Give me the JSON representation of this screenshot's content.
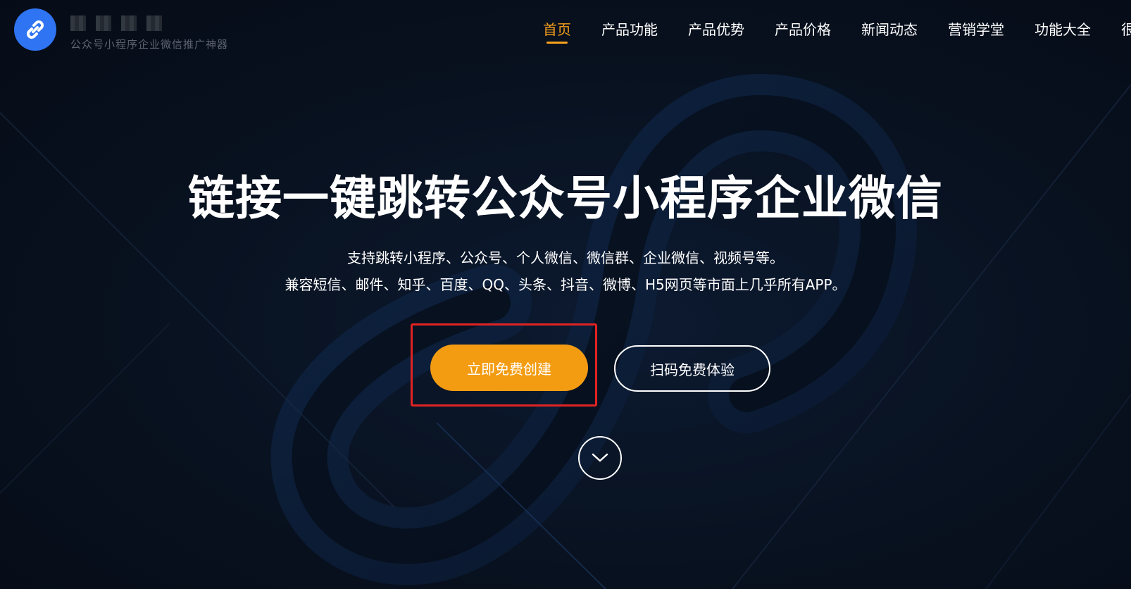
{
  "header": {
    "slogan": "公众号小程序企业微信推广神器",
    "nav": [
      {
        "label": "首页",
        "active": true
      },
      {
        "label": "产品功能"
      },
      {
        "label": "产品优势"
      },
      {
        "label": "产品价格"
      },
      {
        "label": "新闻动态"
      },
      {
        "label": "营销学堂"
      },
      {
        "label": "功能大全"
      },
      {
        "label": "很"
      }
    ]
  },
  "hero": {
    "title": "链接一键跳转公众号小程序企业微信",
    "subtitle_line1": "支持跳转小程序、公众号、个人微信、微信群、企业微信、视频号等。",
    "subtitle_line2": "兼容短信、邮件、知乎、百度、QQ、头条、抖音、微博、H5网页等市面上几乎所有APP。",
    "primary_button": "立即免费创建",
    "secondary_button": "扫码免费体验"
  },
  "colors": {
    "accent": "#f39c12",
    "nav_active": "#f7a11b",
    "logo": "#2f74f2",
    "highlight": "#e02323",
    "background": "#08101e"
  },
  "icons": {
    "logo": "link-icon",
    "scroll": "chevron-down-icon"
  }
}
